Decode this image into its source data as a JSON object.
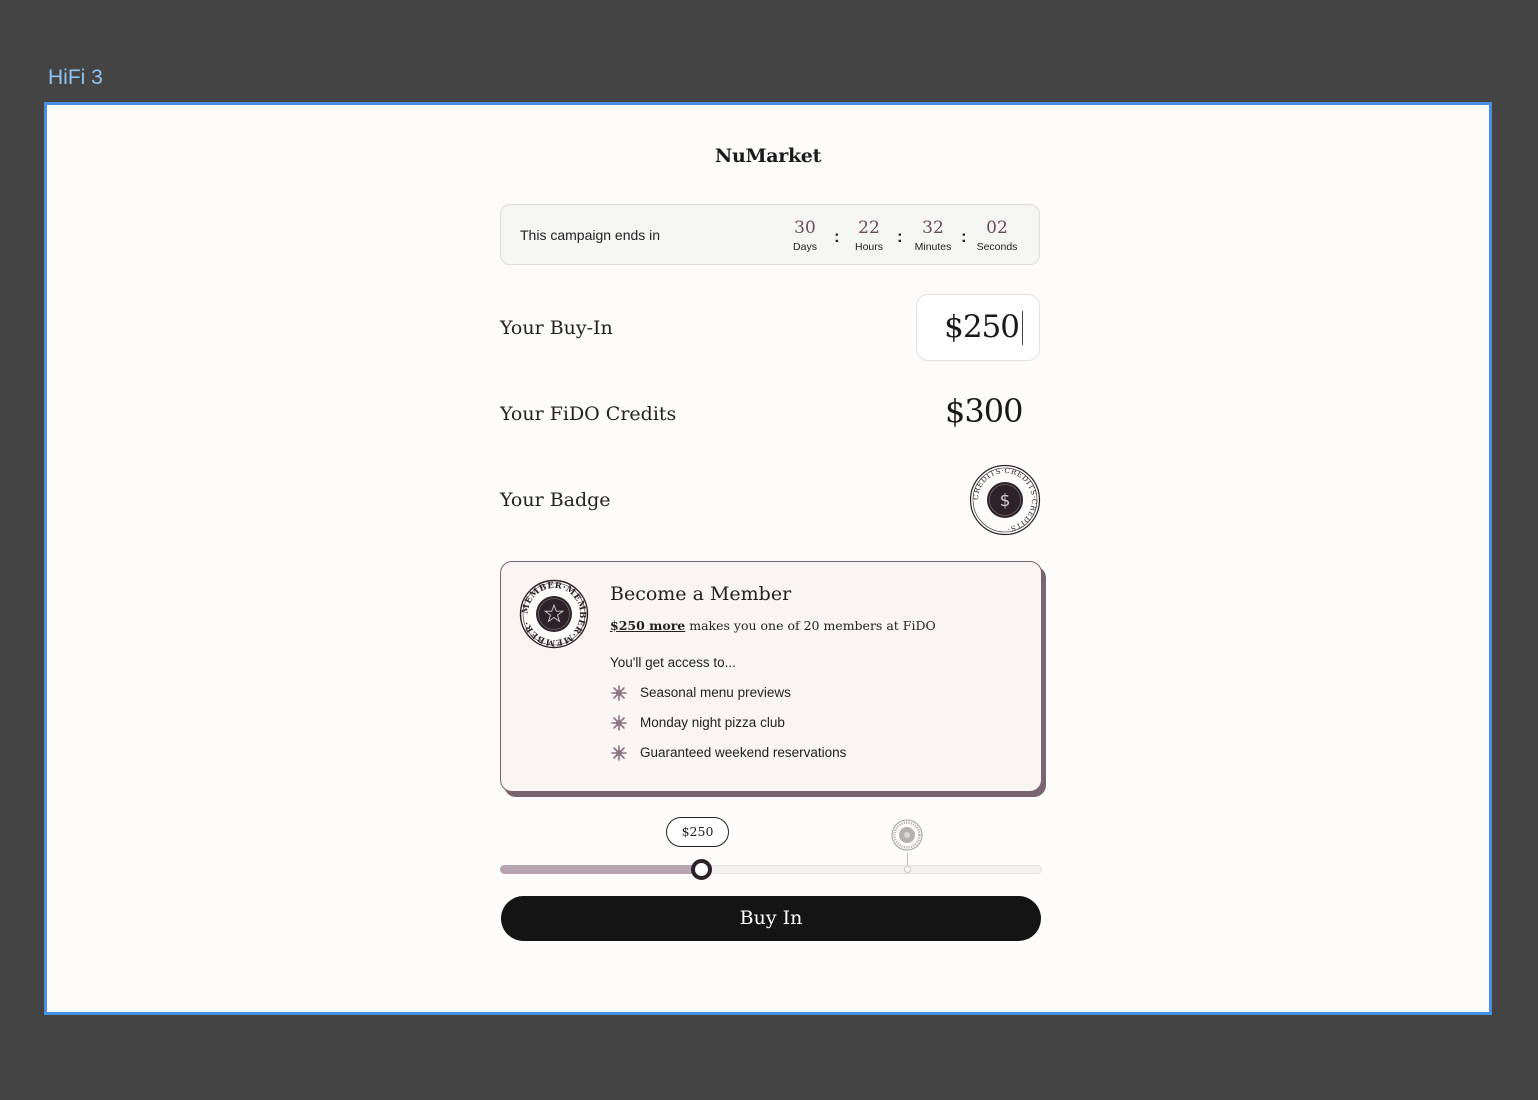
{
  "frame": {
    "label": "HiFi 3"
  },
  "header": {
    "brand": "NuMarket"
  },
  "countdown": {
    "label": "This campaign ends in",
    "days": "30",
    "days_label": "Days",
    "hours": "22",
    "hours_label": "Hours",
    "minutes": "32",
    "minutes_label": "Minutes",
    "seconds": "02",
    "seconds_label": "Seconds",
    "separator": ":"
  },
  "buyin": {
    "label": "Your Buy-In",
    "value": "$250"
  },
  "credits": {
    "label": "Your FiDO Credits",
    "value": "$300"
  },
  "badge": {
    "label": "Your Badge",
    "ring_text": "CREDITS·CREDITS·CREDITS·",
    "symbol": "$"
  },
  "member": {
    "title": "Become a Member",
    "amount_link": "$250 more",
    "subtitle_rest": " makes you one of 20 members at FiDO",
    "access_intro": "You'll get access to...",
    "ring_text": "MEMBER·MEMBER·MEMBER·",
    "perks": [
      "Seasonal menu previews",
      "Monday night pizza club",
      "Guaranteed weekend reservations"
    ]
  },
  "slider": {
    "current_label": "$250",
    "fill_fraction": 0.37,
    "milestone_fraction": 0.757
  },
  "actions": {
    "buy_label": "Buy In"
  },
  "colors": {
    "accent": "#6c4a5c",
    "card_border": "#7a6470",
    "slider_fill": "#b7a4b1",
    "button": "#141414",
    "frame_border": "#4a90e2"
  }
}
